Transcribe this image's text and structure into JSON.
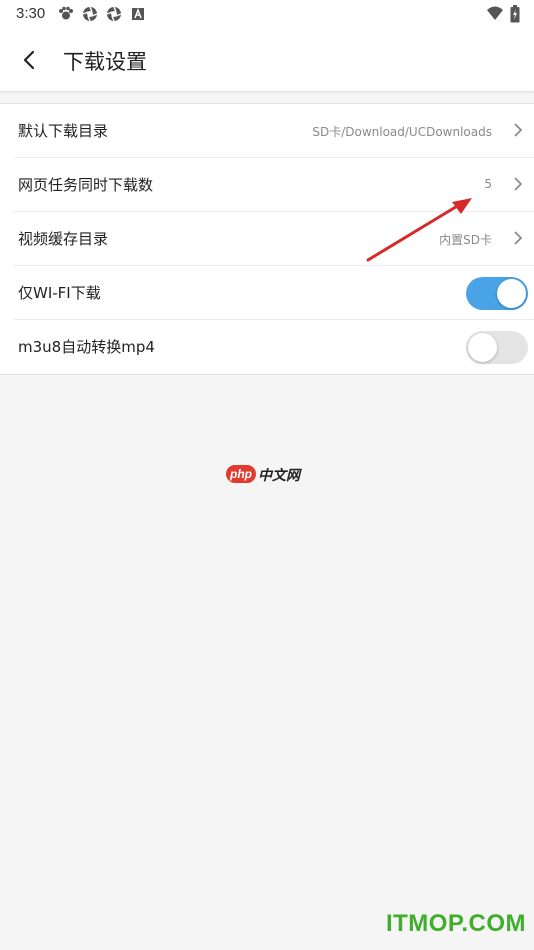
{
  "status_bar": {
    "time": "3:30",
    "left_icons": [
      "paw-icon",
      "aperture-icon",
      "aperture-icon",
      "a-icon"
    ],
    "right_icons": [
      "wifi-icon",
      "battery-charging-icon"
    ]
  },
  "app_bar": {
    "back_icon": "back-arrow-icon",
    "title": "下载设置"
  },
  "settings": {
    "items": [
      {
        "label": "默认下载目录",
        "value": "SD卡/Download/UCDownloads",
        "type": "link"
      },
      {
        "label": "网页任务同时下载数",
        "value": "5",
        "type": "link"
      },
      {
        "label": "视频缓存目录",
        "value": "内置SD卡",
        "type": "link"
      },
      {
        "label": "仅WI-FI下载",
        "type": "toggle",
        "on": true
      },
      {
        "label": "m3u8自动转换mp4",
        "type": "toggle",
        "on": false
      }
    ]
  },
  "watermarks": {
    "php_badge": "php",
    "php_text": "中文网",
    "itmop": "ITMOP.COM"
  },
  "colors": {
    "accent": "#4aa3e6",
    "annotation_arrow": "#d42a2a",
    "itmop_green": "#3fae2a"
  }
}
